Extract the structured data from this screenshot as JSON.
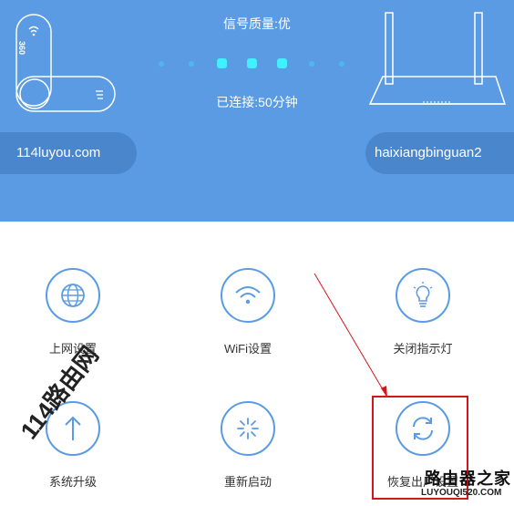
{
  "header": {
    "signal_quality": "信号质量:优",
    "connected_time": "已连接:50分钟",
    "device_domain": "114luyou.com",
    "wifi_name": "haixiangbinguan2",
    "device_logo_text": "360"
  },
  "signal_dots": [
    {
      "active": false
    },
    {
      "active": false
    },
    {
      "active": true
    },
    {
      "active": true
    },
    {
      "active": true
    },
    {
      "active": false
    },
    {
      "active": false
    }
  ],
  "menu": [
    {
      "label": "上网设置",
      "icon": "globe-icon"
    },
    {
      "label": "WiFi设置",
      "icon": "wifi-icon"
    },
    {
      "label": "关闭指示灯",
      "icon": "light-bulb-icon"
    },
    {
      "label": "系统升级",
      "icon": "upgrade-arrow-icon"
    },
    {
      "label": "重新启动",
      "icon": "restart-icon"
    },
    {
      "label": "恢复出厂设置",
      "icon": "factory-reset-icon"
    }
  ],
  "watermarks": {
    "left": "114路由网",
    "right": "路由器之家",
    "right_sub": "LUYOUQI520.COM"
  },
  "colors": {
    "header_bg": "#5b9be3",
    "pill_bg": "#4a86cc",
    "accent": "#5b9be3",
    "highlight": "#d4161a"
  }
}
